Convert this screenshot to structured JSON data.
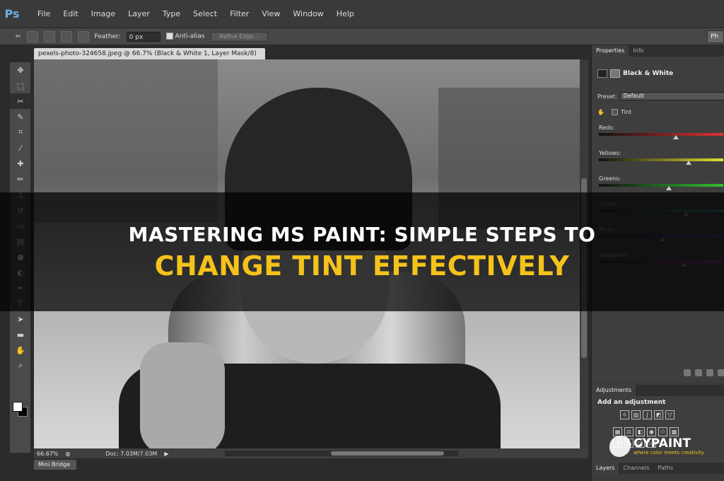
{
  "app": {
    "logo": "Ps"
  },
  "menu": [
    "File",
    "Edit",
    "Image",
    "Layer",
    "Type",
    "Select",
    "Filter",
    "View",
    "Window",
    "Help"
  ],
  "options_bar": {
    "feather_label": "Feather:",
    "feather_value": "0 px",
    "antialias_label": "Anti-alias",
    "refine_edge": "Refine Edge...",
    "right_label": "Ph"
  },
  "document": {
    "tab_title": "pexels-photo-324658.jpeg @ 66.7% (Black & White 1, Layer Mask/8) *",
    "tab_close": "×",
    "zoom": "66.67%",
    "doc_size": "Doc: 7.03M/7.03M",
    "mini_bridge": "Mini Bridge"
  },
  "properties": {
    "tabs": [
      "Properties",
      "Info"
    ],
    "adjustment_name": "Black & White",
    "preset_label": "Preset:",
    "preset_value": "Default",
    "tint_label": "Tint",
    "sliders": [
      {
        "label": "Reds:",
        "color": "#e03030",
        "position": 0.62,
        "dim": false
      },
      {
        "label": "Yellows:",
        "color": "#e0e030",
        "position": 0.72,
        "dim": false
      },
      {
        "label": "Greens:",
        "color": "#30c030",
        "position": 0.56,
        "dim": false
      },
      {
        "label": "Cyans:",
        "color": "#30c0c0",
        "position": 0.7,
        "dim": true
      },
      {
        "label": "Blues:",
        "color": "#3050e0",
        "position": 0.51,
        "dim": true
      },
      {
        "label": "Magentas:",
        "color": "#c030c0",
        "position": 0.68,
        "dim": true
      }
    ]
  },
  "adjustments": {
    "tab": "Adjustments",
    "heading": "Add an adjustment"
  },
  "layers_tabs": [
    "Layers",
    "Channels",
    "Paths"
  ],
  "banner": {
    "line1": "MASTERING MS PAINT: SIMPLE STEPS TO",
    "line2": "CHANGE TINT EFFECTIVELY"
  },
  "watermark": {
    "name": "CYPAINT",
    "tagline": "where color meets creativity"
  }
}
